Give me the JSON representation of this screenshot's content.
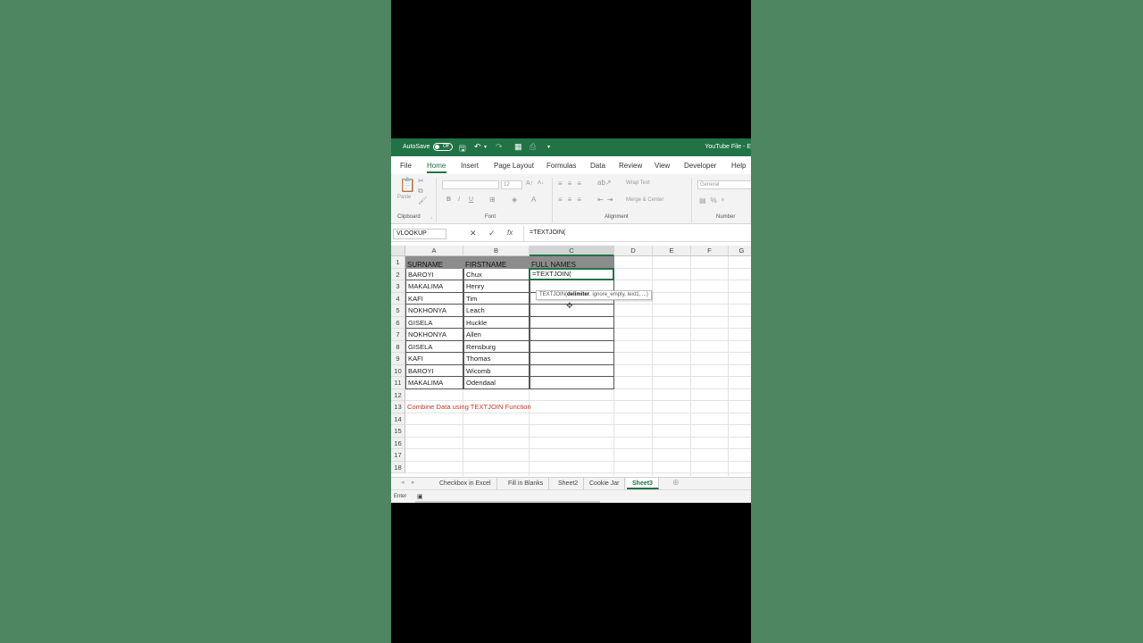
{
  "titlebar": {
    "autosave_label": "AutoSave",
    "autosave_state": "Off",
    "file_name": "YouTube File - E"
  },
  "tabs": [
    "File",
    "Home",
    "Insert",
    "Page Layout",
    "Formulas",
    "Data",
    "Review",
    "View",
    "Developer",
    "Help"
  ],
  "active_tab": "Home",
  "ribbon": {
    "paste_label": "Paste",
    "font_size": "12",
    "wrap_text": "Wrap Text",
    "merge_center": "Merge & Center",
    "number_format": "General",
    "groups": {
      "clipboard": "Clipboard",
      "font": "Font",
      "alignment": "Alignment",
      "number": "Number"
    }
  },
  "formula_bar": {
    "name_box": "VLOOKUP",
    "formula": "=TEXTJOIN(",
    "cancel_icon": "✕",
    "enter_icon": "✓",
    "fx_icon": "fx"
  },
  "grid": {
    "columns": [
      "A",
      "B",
      "C",
      "D",
      "E",
      "F",
      "G"
    ],
    "rows": [
      "1",
      "2",
      "3",
      "4",
      "5",
      "6",
      "7",
      "8",
      "9",
      "10",
      "11",
      "12",
      "13",
      "14",
      "15",
      "16",
      "17",
      "18"
    ],
    "headers": {
      "a": "SURNAME",
      "b": "FIRSTNAME",
      "c": "FULL NAMES"
    },
    "data": [
      [
        "BAROYI",
        "Chux"
      ],
      [
        "MAKALIMA",
        "Henry"
      ],
      [
        "KAFI",
        "Tim"
      ],
      [
        "NOKHONYA",
        "Leach"
      ],
      [
        "GISELA",
        "Huckle"
      ],
      [
        "NOKHONYA",
        "Allen"
      ],
      [
        "GISELA",
        "Rensburg"
      ],
      [
        "KAFI",
        "Thomas"
      ],
      [
        "BAROYI",
        "Wicomb"
      ],
      [
        "MAKALIMA",
        "Odendaal"
      ]
    ],
    "active_cell_value": "=TEXTJOIN(",
    "tooltip": {
      "fn": "TEXTJOIN(",
      "bold_arg": "delimiter",
      "rest": ", ignore_empty, text1, ...)"
    },
    "note": "Combine Data using TEXTJOIN Function"
  },
  "sheets": [
    "Checkbox in Excel",
    "Fill in Blanks",
    "Sheet2",
    "Cookie Jar",
    "Sheet3"
  ],
  "active_sheet": "Sheet3",
  "status": {
    "mode": "Enter"
  },
  "colors": {
    "excel_green": "#217346",
    "background": "#4e8661",
    "note_red": "#c0392b",
    "header_fill": "#8c8c8c"
  }
}
